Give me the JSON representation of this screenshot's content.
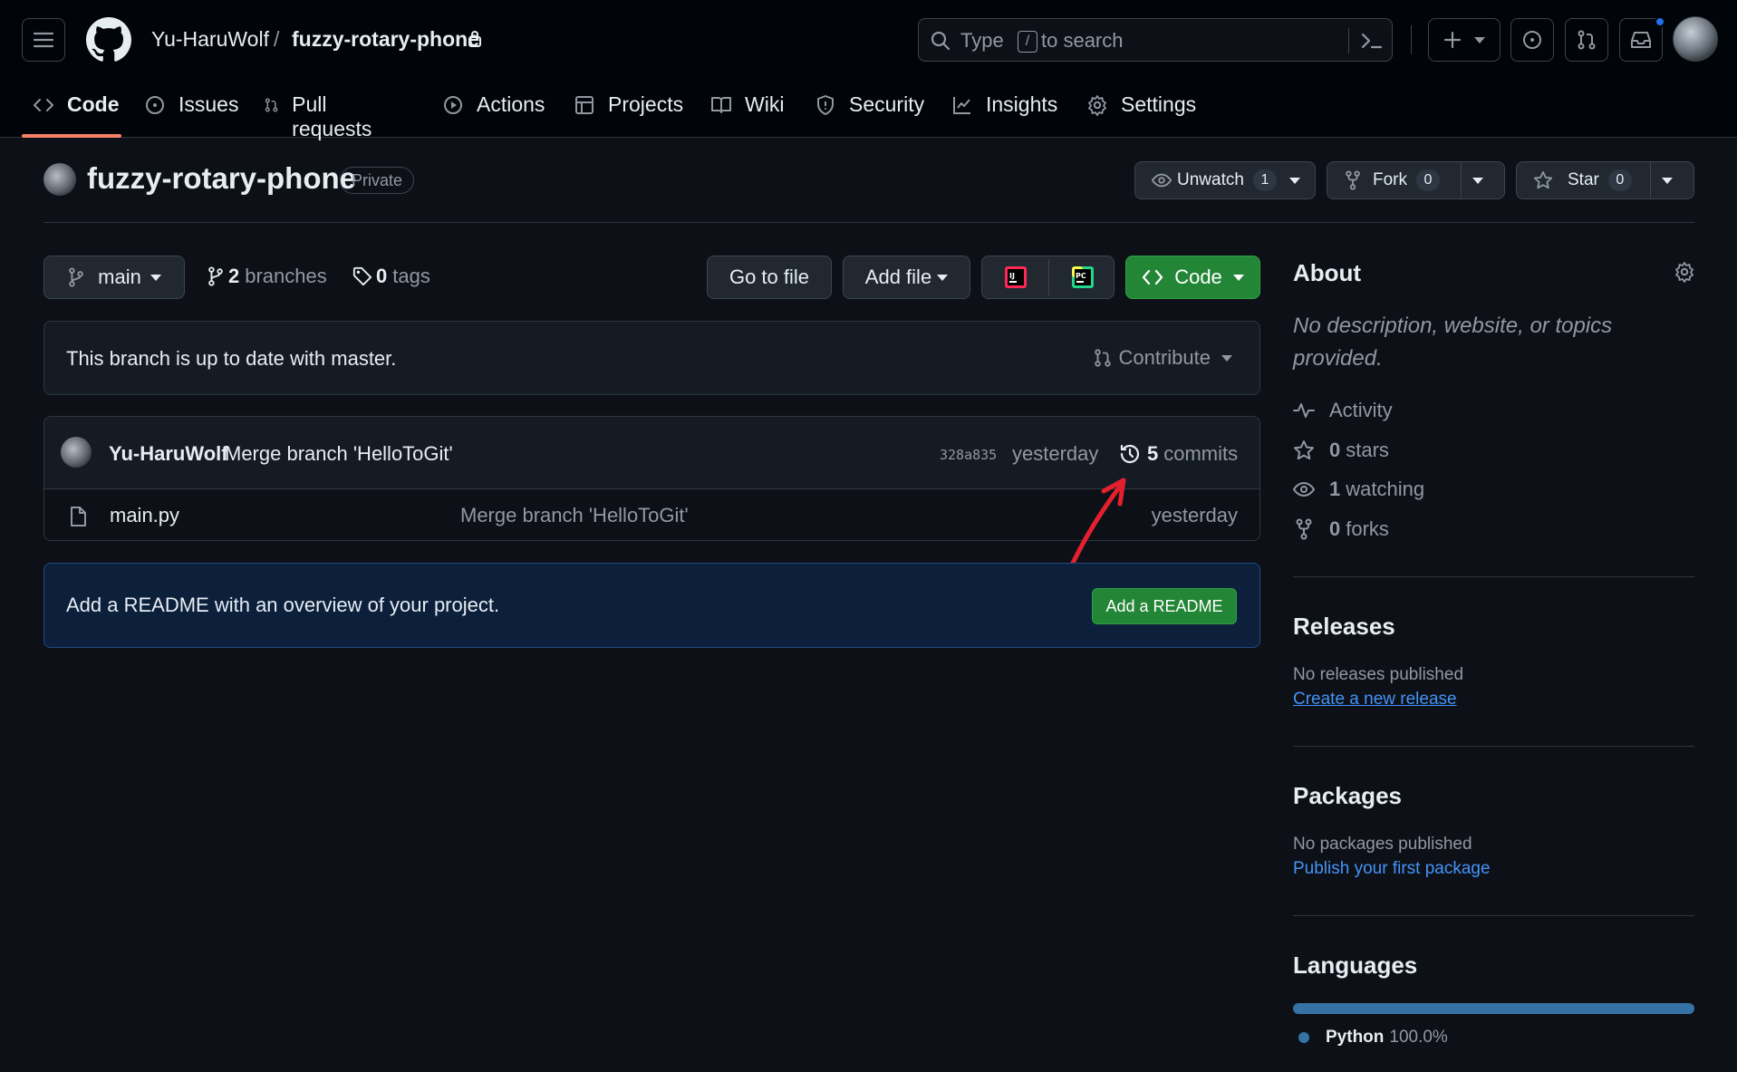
{
  "header": {
    "owner": "Yu-HaruWolf",
    "separator": "/",
    "repo": "fuzzy-rotary-phone",
    "search_prefix": "Type",
    "search_key": "/",
    "search_suffix": "to search"
  },
  "tabs": [
    {
      "label": "Code",
      "icon": "code-icon"
    },
    {
      "label": "Issues",
      "icon": "issue-icon"
    },
    {
      "label": "Pull requests",
      "icon": "pull-request-icon"
    },
    {
      "label": "Actions",
      "icon": "play-icon"
    },
    {
      "label": "Projects",
      "icon": "table-icon"
    },
    {
      "label": "Wiki",
      "icon": "book-icon"
    },
    {
      "label": "Security",
      "icon": "shield-icon"
    },
    {
      "label": "Insights",
      "icon": "graph-icon"
    },
    {
      "label": "Settings",
      "icon": "gear-icon"
    }
  ],
  "repo_header": {
    "name": "fuzzy-rotary-phone",
    "visibility": "Private",
    "unwatch_label": "Unwatch",
    "watch_count": "1",
    "fork_label": "Fork",
    "fork_count": "0",
    "star_label": "Star",
    "star_count": "0"
  },
  "toolbar": {
    "branch": "main",
    "branches_count": "2",
    "branches_label": "branches",
    "tags_count": "0",
    "tags_label": "tags",
    "go_to_file": "Go to file",
    "add_file": "Add file",
    "code": "Code"
  },
  "branch_status": {
    "text": "This branch is up to date with master.",
    "contribute": "Contribute"
  },
  "latest_commit": {
    "author": "Yu-HaruWolf",
    "message": "Merge branch 'HelloToGit'",
    "sha": "328a835",
    "time": "yesterday",
    "commits_count": "5",
    "commits_label": "commits"
  },
  "files": [
    {
      "name": "main.py",
      "message": "Merge branch 'HelloToGit'",
      "time": "yesterday"
    }
  ],
  "readme_prompt": {
    "text": "Add a README with an overview of your project.",
    "button": "Add a README"
  },
  "about": {
    "title": "About",
    "description": "No description, website, or topics provided.",
    "activity": "Activity",
    "stars_count": "0",
    "stars_label": "stars",
    "watching_count": "1",
    "watching_label": "watching",
    "forks_count": "0",
    "forks_label": "forks"
  },
  "releases": {
    "title": "Releases",
    "empty": "No releases published",
    "link": "Create a new release"
  },
  "packages": {
    "title": "Packages",
    "empty": "No packages published",
    "link": "Publish your first package"
  },
  "languages": {
    "title": "Languages",
    "items": [
      {
        "name": "Python",
        "percent": "100.0%",
        "color": "#3572a5"
      }
    ]
  },
  "colors": {
    "background": "#0d1117",
    "header": "#010409",
    "accent_green": "#238636",
    "link_blue": "#4493f8",
    "active_tab_underline": "#f78166",
    "annotation_arrow": "#e5202e"
  }
}
